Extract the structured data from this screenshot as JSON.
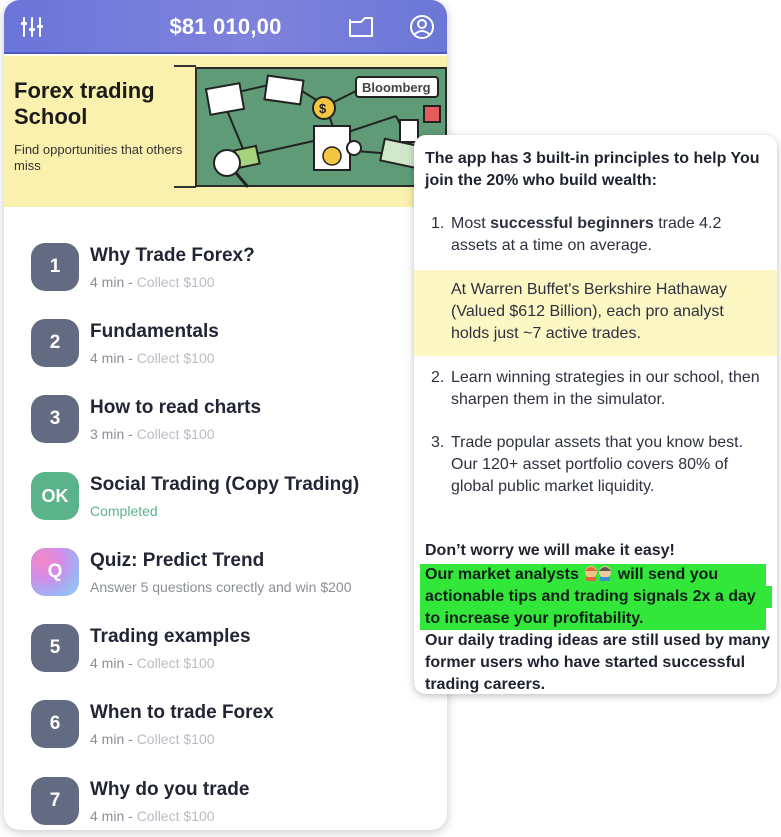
{
  "topbar": {
    "balance": "$81 010,00",
    "icons": [
      "sliders-icon",
      "folder-icon",
      "profile-icon"
    ]
  },
  "banner": {
    "title_line1": "Forex trading",
    "title_line2": "School",
    "subtitle": "Find opportunities that others miss",
    "image_label": "Bloomberg"
  },
  "lessons": [
    {
      "badge": "1",
      "name": "Why Trade Forex?",
      "duration": "4 min",
      "sep": " - ",
      "reward": "Collect $100"
    },
    {
      "badge": "2",
      "name": "Fundamentals",
      "duration": "4 min",
      "sep": " - ",
      "reward": "Collect $100"
    },
    {
      "badge": "3",
      "name": "How to read charts",
      "duration": "3 min",
      "sep": " - ",
      "reward": "Collect $100"
    },
    {
      "badge": "OK",
      "name": "Social Trading (Copy Trading)",
      "status": "Completed"
    },
    {
      "badge": "Q",
      "name": "Quiz: Predict Trend",
      "status": "Answer 5 questions corectly and win $200"
    },
    {
      "badge": "5",
      "name": "Trading examples",
      "duration": "4 min",
      "sep": " - ",
      "reward": "Collect $100"
    },
    {
      "badge": "6",
      "name": "When to trade Forex",
      "duration": "4 min",
      "sep": " - ",
      "reward": "Collect $100"
    },
    {
      "badge": "7",
      "name": "Why do you trade",
      "duration": "4 min",
      "sep": " - ",
      "reward": "Collect $100"
    }
  ],
  "info": {
    "intro": "The app has 3 built-in principles to help You join the 20% who build wealth:",
    "p1_num": "1.",
    "p1_pre": "Most ",
    "p1_bold": "successful beginners",
    "p1_post": " trade 4.2 assets at a time on average.",
    "highlight": "At Warren Buffet's Berkshire Hathaway (Valued $612 Billion), each pro analyst holds just ~7 active trades.",
    "p2_num": "2.",
    "p2": "Learn winning strategies in our school, then sharpen them in the simulator.",
    "p3_num": "3.",
    "p3": "Trade popular assets that you know best. Our 120+ asset portfolio covers 80% of global public market liquidity.",
    "outro": "Don’t worry we will make it easy!",
    "green_pre": "Our market analysts ",
    "green_post": " will send you actionable tips and trading signals 2x a day to increase your profitability.",
    "tail": "Our daily trading ideas are still used by many former users who have started successful trading careers."
  },
  "colors": {
    "topbar": "#6b75d8",
    "banner": "#fbf1ae",
    "badge": "#636b82",
    "badge_ok": "#5ab38a",
    "highlight_yellow": "#fdf7c4",
    "highlight_green": "#33e63a"
  }
}
